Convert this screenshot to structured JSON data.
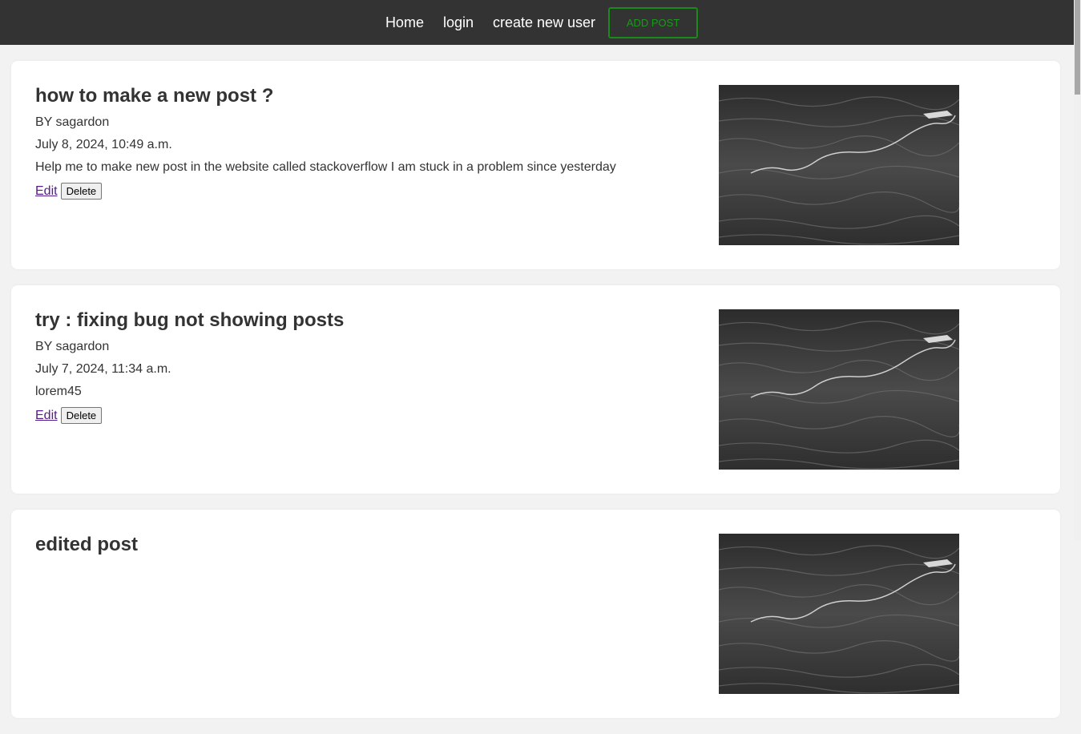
{
  "nav": {
    "home": "Home",
    "login": "login",
    "create_user": "create new user",
    "add_post": "ADD POST"
  },
  "posts": [
    {
      "title": "how to make a new post ?",
      "author": "BY sagardon",
      "date": "July 8, 2024, 10:49 a.m.",
      "body": "Help me to make new post in the website called stackoverflow I am stuck in a problem since yesterday",
      "edit": "Edit",
      "delete": "Delete"
    },
    {
      "title": "try : fixing bug not showing posts",
      "author": "BY sagardon",
      "date": "July 7, 2024, 11:34 a.m.",
      "body": "lorem45",
      "edit": "Edit",
      "delete": "Delete"
    },
    {
      "title": "edited post",
      "author": "",
      "date": "",
      "body": "",
      "edit": "",
      "delete": ""
    }
  ],
  "colors": {
    "nav_bg": "#333333",
    "page_bg": "#f2f2f2",
    "add_post_accent": "#1a9a1a",
    "link_visited": "#551a8b"
  },
  "icons": {
    "post_image": "ocean-water-image"
  }
}
